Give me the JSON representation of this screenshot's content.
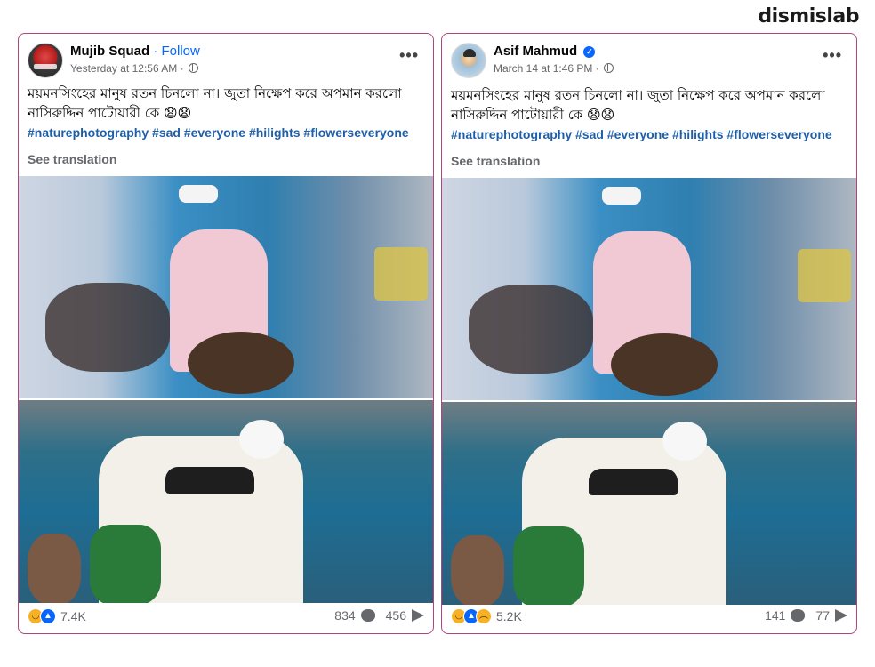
{
  "brand": "dismislab",
  "posts": [
    {
      "author": "Mujib Squad",
      "separator": "·",
      "follow_label": "Follow",
      "timestamp": "Yesterday at 12:56 AM",
      "meta_separator": "·",
      "verified": false,
      "more_label": "•••",
      "caption_line1": "ময়মনসিংহের মানুষ রতন চিনলো না। জুতা নিক্ষেপ করে অপমান করলো",
      "caption_line2": "নাসিরুদ্দিন পাটোয়ারী কে 😧😧",
      "hashtags": "#naturephotography #sad #everyone #hilights #flowerseveryone",
      "see_translation": "See translation",
      "reaction_count": "7.4K",
      "comment_count": "834",
      "share_count": "456",
      "reaction_icons": [
        "haha-icon",
        "like-icon"
      ]
    },
    {
      "author": "Asif Mahmud",
      "separator": "",
      "follow_label": "",
      "timestamp": "March 14 at 1:46 PM",
      "meta_separator": "·",
      "verified": true,
      "verified_glyph": "✓",
      "more_label": "•••",
      "caption_line1": "ময়মনসিংহের মানুষ রতন চিনলো না। জুতা নিক্ষেপ করে অপমান করলো",
      "caption_line2": "নাসিরুদ্দিন পাটোয়ারী কে 😧😧",
      "hashtags": "#naturephotography #sad #everyone #hilights #flowerseveryone",
      "see_translation": "See translation",
      "reaction_count": "5.2K",
      "comment_count": "141",
      "share_count": "77",
      "reaction_icons": [
        "haha-icon",
        "like-icon",
        "sad-icon"
      ]
    }
  ],
  "colors": {
    "border": "#b0457e",
    "link": "#0866ff",
    "hashtag": "#1f5fa8",
    "muted": "#65676b"
  }
}
